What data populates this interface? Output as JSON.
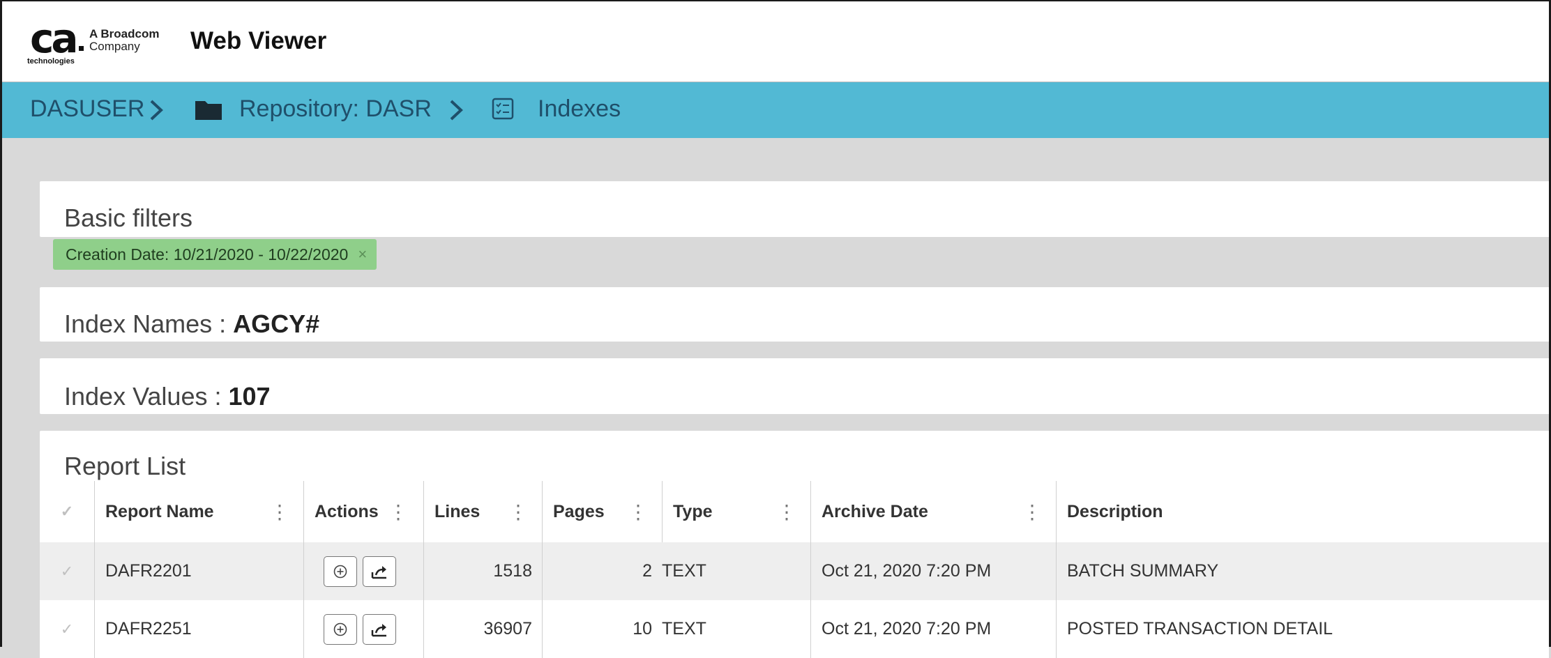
{
  "header": {
    "logo_text": "ca",
    "logo_subtext": "technologies",
    "company_line1": "A Broadcom",
    "company_line2": "Company",
    "app_title": "Web Viewer"
  },
  "breadcrumb": {
    "user": "DASUSER",
    "repository": "Repository: DASR",
    "current": "Indexes"
  },
  "filters": {
    "title": "Basic filters",
    "chip_label": "Creation Date: 10/21/2020 - 10/22/2020",
    "chip_close": "×"
  },
  "index_names": {
    "label": "Index Names :",
    "value": "AGCY#"
  },
  "index_values": {
    "label": "Index Values :",
    "value": "107"
  },
  "report_list": {
    "title": "Report List",
    "columns": [
      "Report Name",
      "Actions",
      "Lines",
      "Pages",
      "Type",
      "Archive Date",
      "Description"
    ],
    "column_menu_glyph": "⋮",
    "check_glyph": "✓",
    "rows": [
      {
        "report_name": "DAFR2201",
        "lines": "1518",
        "pages": "2",
        "type": "TEXT",
        "archive_date": "Oct 21, 2020 7:20 PM",
        "description": "BATCH SUMMARY"
      },
      {
        "report_name": "DAFR2251",
        "lines": "36907",
        "pages": "10",
        "type": "TEXT",
        "archive_date": "Oct 21, 2020 7:20 PM",
        "description": "POSTED TRANSACTION DETAIL"
      }
    ]
  },
  "colors": {
    "breadcrumb_bar": "#52b9d4",
    "breadcrumb_text": "#1f4f6a",
    "filter_chip": "#8fcf8a",
    "row_alt": "#eeeeee"
  }
}
